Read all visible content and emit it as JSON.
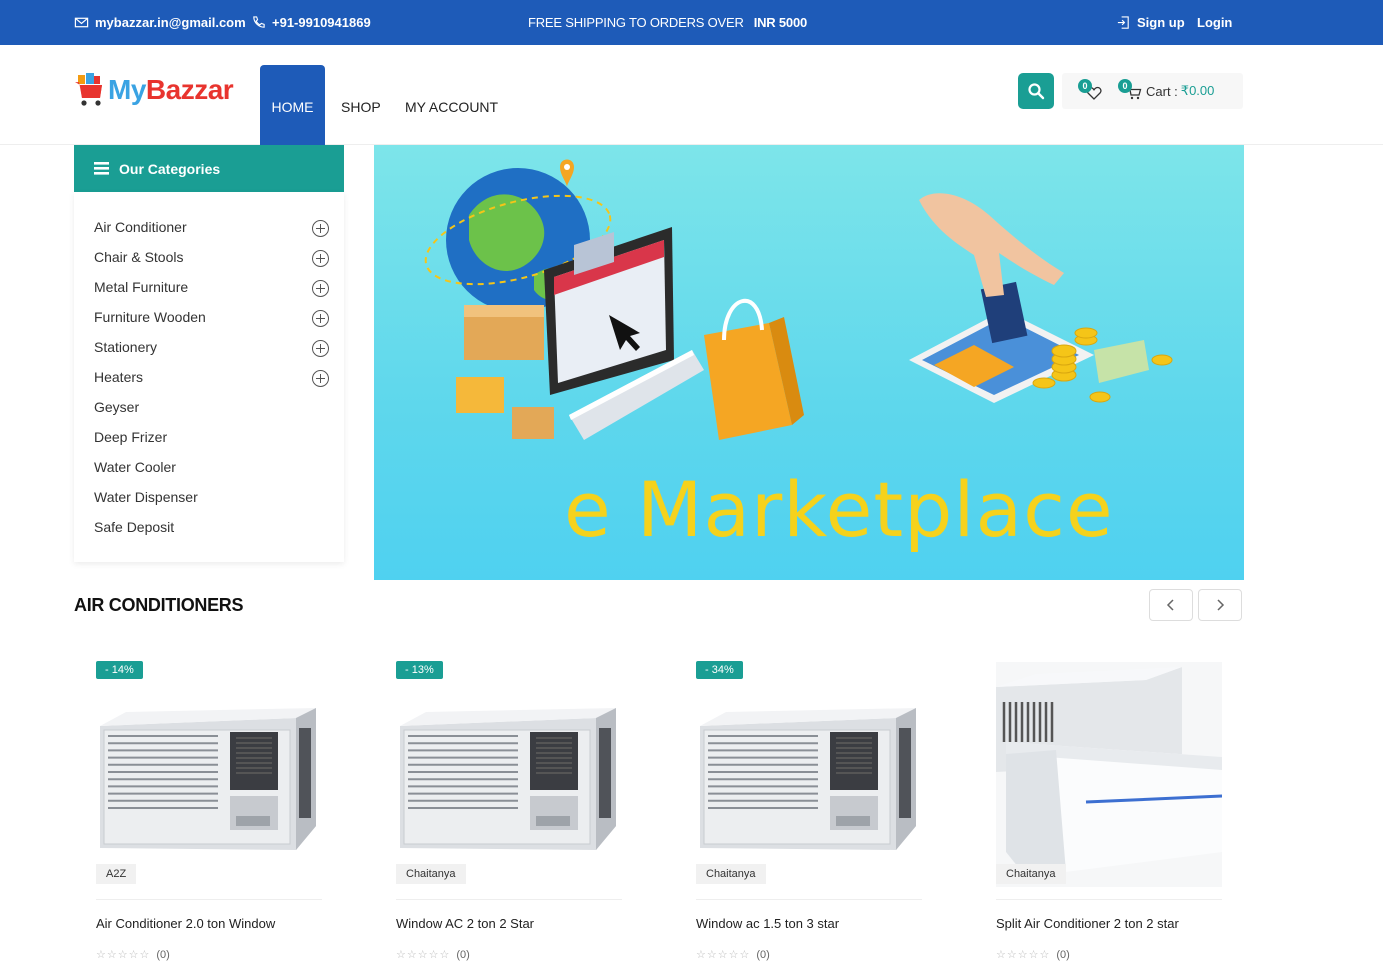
{
  "topbar": {
    "email": "mybazzar.in@gmail.com",
    "phone": "+91-9910941869",
    "shipping_text": "FREE SHIPPING TO ORDERS OVER ",
    "shipping_amount": "INR 5000",
    "signup": "Sign up",
    "login": "Login"
  },
  "header": {
    "logo_my": "My",
    "logo_bazzar": "Bazzar",
    "nav": {
      "home": "HOME",
      "shop": "SHOP",
      "account": "MY ACCOUNT"
    },
    "wishlist_count": "0",
    "cart_count": "0",
    "cart_label": "Cart :",
    "cart_amount": "₹0.00"
  },
  "sidebar": {
    "title": "Our Categories",
    "items": [
      {
        "label": "Air Conditioner",
        "expandable": true
      },
      {
        "label": "Chair & Stools",
        "expandable": true
      },
      {
        "label": "Metal Furniture",
        "expandable": true
      },
      {
        "label": "Furniture Wooden",
        "expandable": true
      },
      {
        "label": "Stationery",
        "expandable": true
      },
      {
        "label": "Heaters",
        "expandable": true
      },
      {
        "label": "Geyser",
        "expandable": false
      },
      {
        "label": "Deep Frizer",
        "expandable": false
      },
      {
        "label": "Water Cooler",
        "expandable": false
      },
      {
        "label": "Water Dispenser",
        "expandable": false
      },
      {
        "label": "Safe Deposit",
        "expandable": false
      }
    ]
  },
  "banner": {
    "title": "e Marketplace"
  },
  "section": {
    "title": "AIR CONDITIONERS",
    "products": [
      {
        "discount": "- 14%",
        "brand": "A2Z",
        "name": "Air Conditioner 2.0 ton Window",
        "stars": "☆☆☆☆☆",
        "reviews": "(0)",
        "type": "window"
      },
      {
        "discount": "- 13%",
        "brand": "Chaitanya",
        "name": "Window AC 2 ton 2 Star",
        "stars": "☆☆☆☆☆",
        "reviews": "(0)",
        "type": "window"
      },
      {
        "discount": "- 34%",
        "brand": "Chaitanya",
        "name": "Window ac 1.5 ton 3 star",
        "stars": "☆☆☆☆☆",
        "reviews": "(0)",
        "type": "window"
      },
      {
        "discount": "",
        "brand": "Chaitanya",
        "name": "Split Air Conditioner 2 ton 2 star",
        "stars": "☆☆☆☆☆",
        "reviews": "(0)",
        "type": "split"
      }
    ]
  },
  "colors": {
    "primary_blue": "#1e5bb8",
    "teal": "#1a9e94",
    "banner_yellow": "#f5d21c"
  }
}
